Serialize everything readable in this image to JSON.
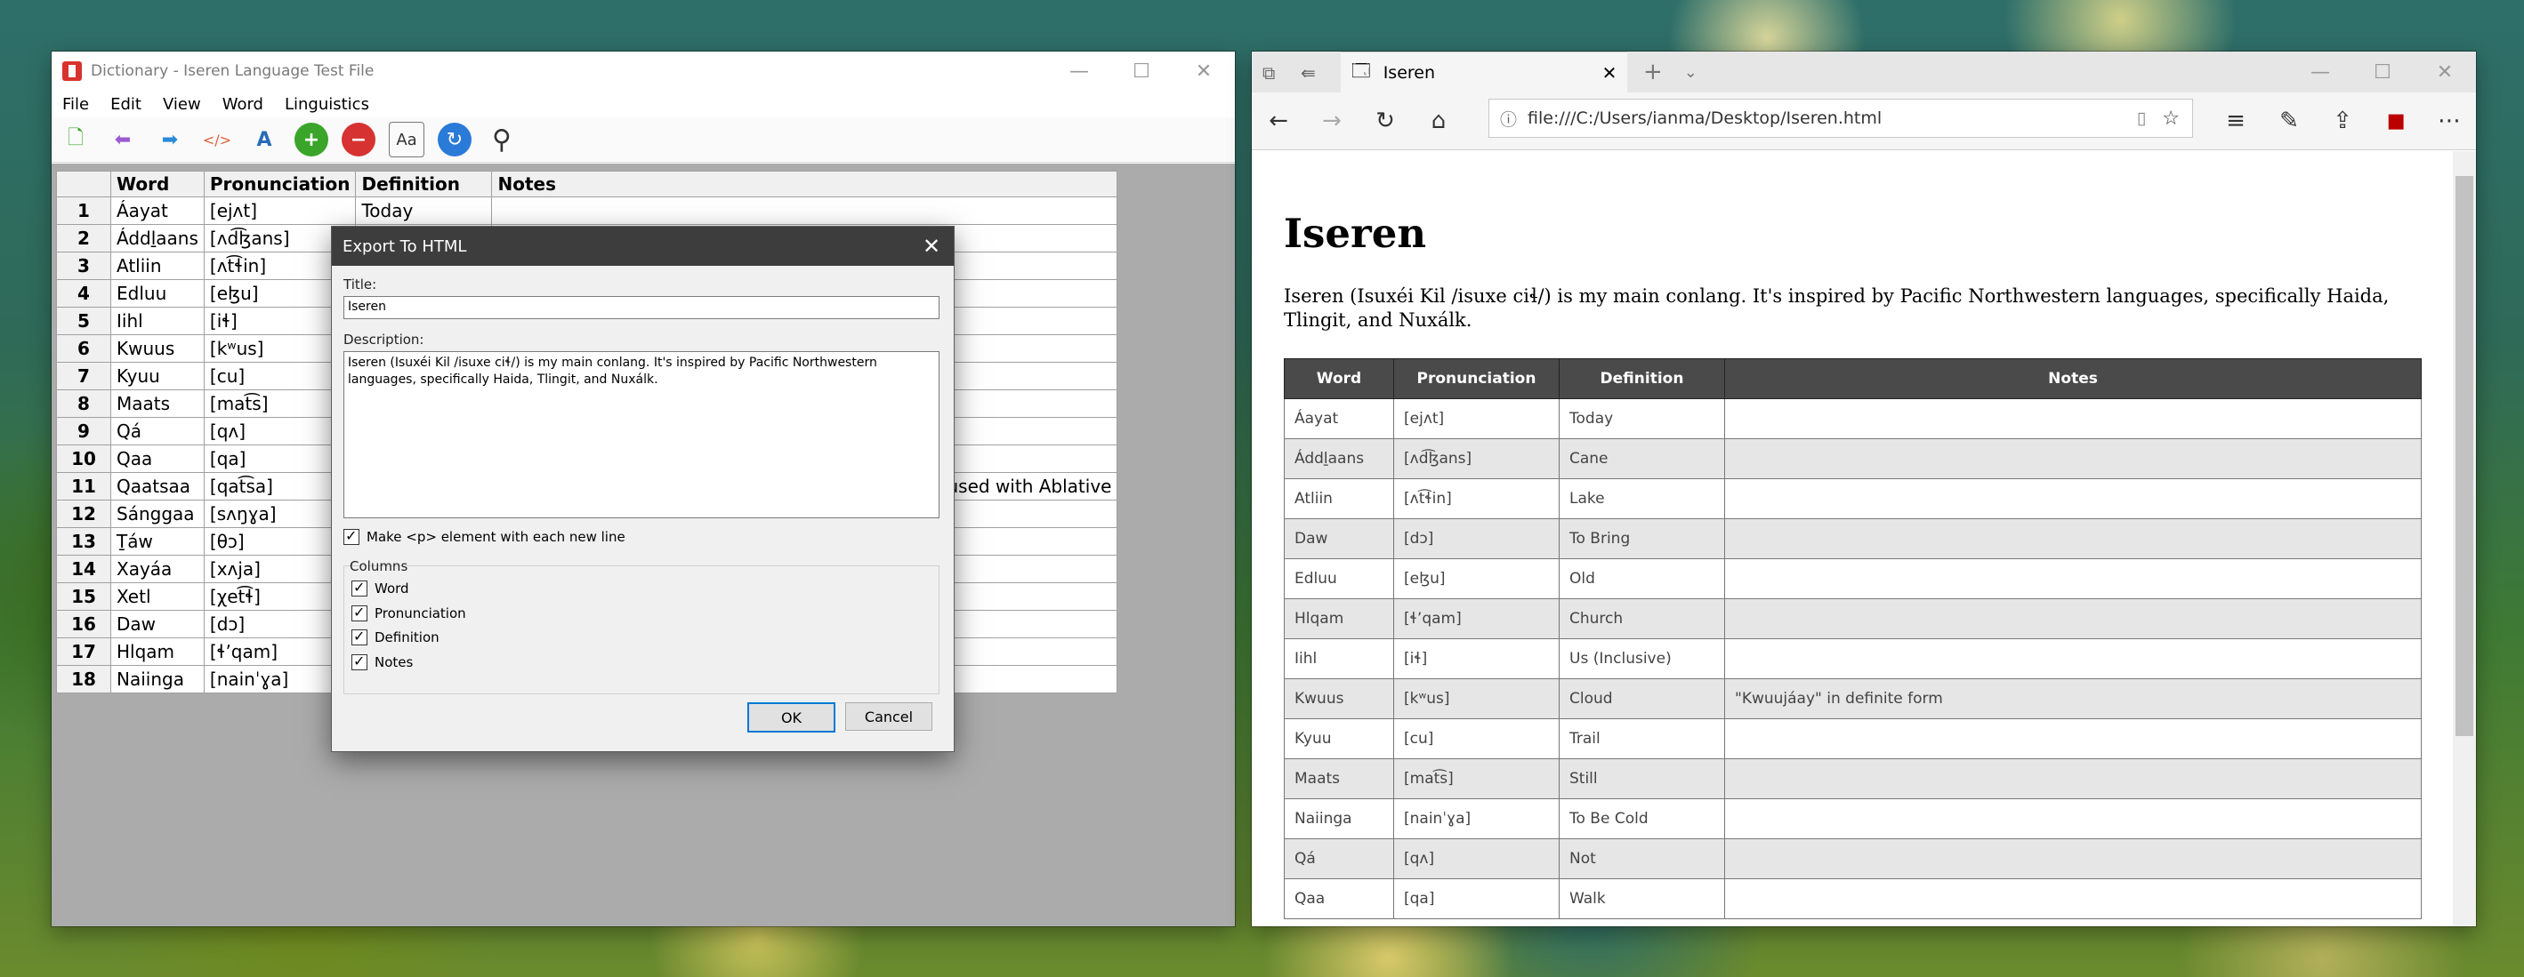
{
  "dictionary": {
    "window_title": "Dictionary - Iseren Language Test File",
    "menu": [
      "File",
      "Edit",
      "View",
      "Word",
      "Linguistics"
    ],
    "toolbar_icons": [
      "new-file-icon",
      "back-arrow-icon",
      "forward-arrow-icon",
      "code-icon",
      "translate-icon",
      "add-icon",
      "remove-icon",
      "font-icon",
      "refresh-icon",
      "search-icon"
    ],
    "columns": [
      "Word",
      "Pronunciation",
      "Definition",
      "Notes"
    ],
    "rows": [
      {
        "n": "1",
        "word": "Áayat",
        "pron": "[ejʌt]",
        "def": "Today",
        "notes": ""
      },
      {
        "n": "2",
        "word": "Áddḻaans",
        "pron": "[ʌd͡ɮans]",
        "def": "",
        "notes": ""
      },
      {
        "n": "3",
        "word": "Atliin",
        "pron": "[ʌt͡ɬin]",
        "def": "",
        "notes": ""
      },
      {
        "n": "4",
        "word": "Edluu",
        "pron": "[eɮu]",
        "def": "",
        "notes": ""
      },
      {
        "n": "5",
        "word": "Iihl",
        "pron": "[iɬ]",
        "def": "",
        "notes": ""
      },
      {
        "n": "6",
        "word": "Kwuus",
        "pron": "[kʷus]",
        "def": "",
        "notes": ""
      },
      {
        "n": "7",
        "word": "Kyuu",
        "pron": "[cu]",
        "def": "",
        "notes": ""
      },
      {
        "n": "8",
        "word": "Maats",
        "pron": "[mat͡s]",
        "def": "",
        "notes": ""
      },
      {
        "n": "9",
        "word": "Qá",
        "pron": "[qʌ]",
        "def": "",
        "notes": ""
      },
      {
        "n": "10",
        "word": "Qaa",
        "pron": "[qa]",
        "def": "",
        "notes": ""
      },
      {
        "n": "11",
        "word": "Qaatsaa",
        "pron": "[qat͡sa]",
        "def": "",
        "notes": "used with Ablative"
      },
      {
        "n": "12",
        "word": "Sánggaa",
        "pron": "[sʌŋɣa]",
        "def": "",
        "notes": ""
      },
      {
        "n": "13",
        "word": "Ṯáw",
        "pron": "[θɔ]",
        "def": "",
        "notes": ""
      },
      {
        "n": "14",
        "word": "Xayáa",
        "pron": "[xʌja]",
        "def": "",
        "notes": ""
      },
      {
        "n": "15",
        "word": "Xetl",
        "pron": "[χet͡ɬ]",
        "def": "",
        "notes": ""
      },
      {
        "n": "16",
        "word": "Daw",
        "pron": "[dɔ]",
        "def": "",
        "notes": ""
      },
      {
        "n": "17",
        "word": "Hlqam",
        "pron": "[ɬʼqam]",
        "def": "",
        "notes": ""
      },
      {
        "n": "18",
        "word": "Naiinga",
        "pron": "[nainˈɣa]",
        "def": "",
        "notes": ""
      }
    ]
  },
  "dialog": {
    "title": "Export To HTML",
    "title_label": "Title:",
    "title_value": "Iseren",
    "description_label": "Description:",
    "description_value": "Iseren (Isuxéi Kil /isuxe ciɬ/) is my main conlang. It's inspired by Pacific Northwestern languages, specifically Haida, Tlingit, and Nuxálk.",
    "make_p_label": "Make <p> element with each new line",
    "columns_label": "Columns",
    "column_options": [
      "Word",
      "Pronunciation",
      "Definition",
      "Notes"
    ],
    "ok_label": "OK",
    "cancel_label": "Cancel"
  },
  "browser": {
    "tab_title": "Iseren",
    "url": "file:///C:/Users/ianma/Desktop/Iseren.html",
    "page_title": "Iseren",
    "page_description": "Iseren (Isuxéi Kil /isuxe ciɬ/) is my main conlang. It's inspired by Pacific Northwestern languages, specifically Haida, Tlingit, and Nuxálk.",
    "columns": [
      "Word",
      "Pronunciation",
      "Definition",
      "Notes"
    ],
    "rows": [
      {
        "word": "Áayat",
        "pron": "[ejʌt]",
        "def": "Today",
        "notes": ""
      },
      {
        "word": "Áddḻaans",
        "pron": "[ʌd͡ɮans]",
        "def": "Cane",
        "notes": ""
      },
      {
        "word": "Atliin",
        "pron": "[ʌt͡ɬin]",
        "def": "Lake",
        "notes": ""
      },
      {
        "word": "Daw",
        "pron": "[dɔ]",
        "def": "To Bring",
        "notes": ""
      },
      {
        "word": "Edluu",
        "pron": "[eɮu]",
        "def": "Old",
        "notes": ""
      },
      {
        "word": "Hlqam",
        "pron": "[ɬʼqam]",
        "def": "Church",
        "notes": ""
      },
      {
        "word": "Iihl",
        "pron": "[iɬ]",
        "def": "Us (Inclusive)",
        "notes": ""
      },
      {
        "word": "Kwuus",
        "pron": "[kʷus]",
        "def": "Cloud",
        "notes": "\"Kwuujáay\" in definite form"
      },
      {
        "word": "Kyuu",
        "pron": "[cu]",
        "def": "Trail",
        "notes": ""
      },
      {
        "word": "Maats",
        "pron": "[mat͡s]",
        "def": "Still",
        "notes": ""
      },
      {
        "word": "Naiinga",
        "pron": "[nainˈɣa]",
        "def": "To Be Cold",
        "notes": ""
      },
      {
        "word": "Qá",
        "pron": "[qʌ]",
        "def": "Not",
        "notes": ""
      },
      {
        "word": "Qaa",
        "pron": "[qa]",
        "def": "Walk",
        "notes": ""
      }
    ]
  }
}
